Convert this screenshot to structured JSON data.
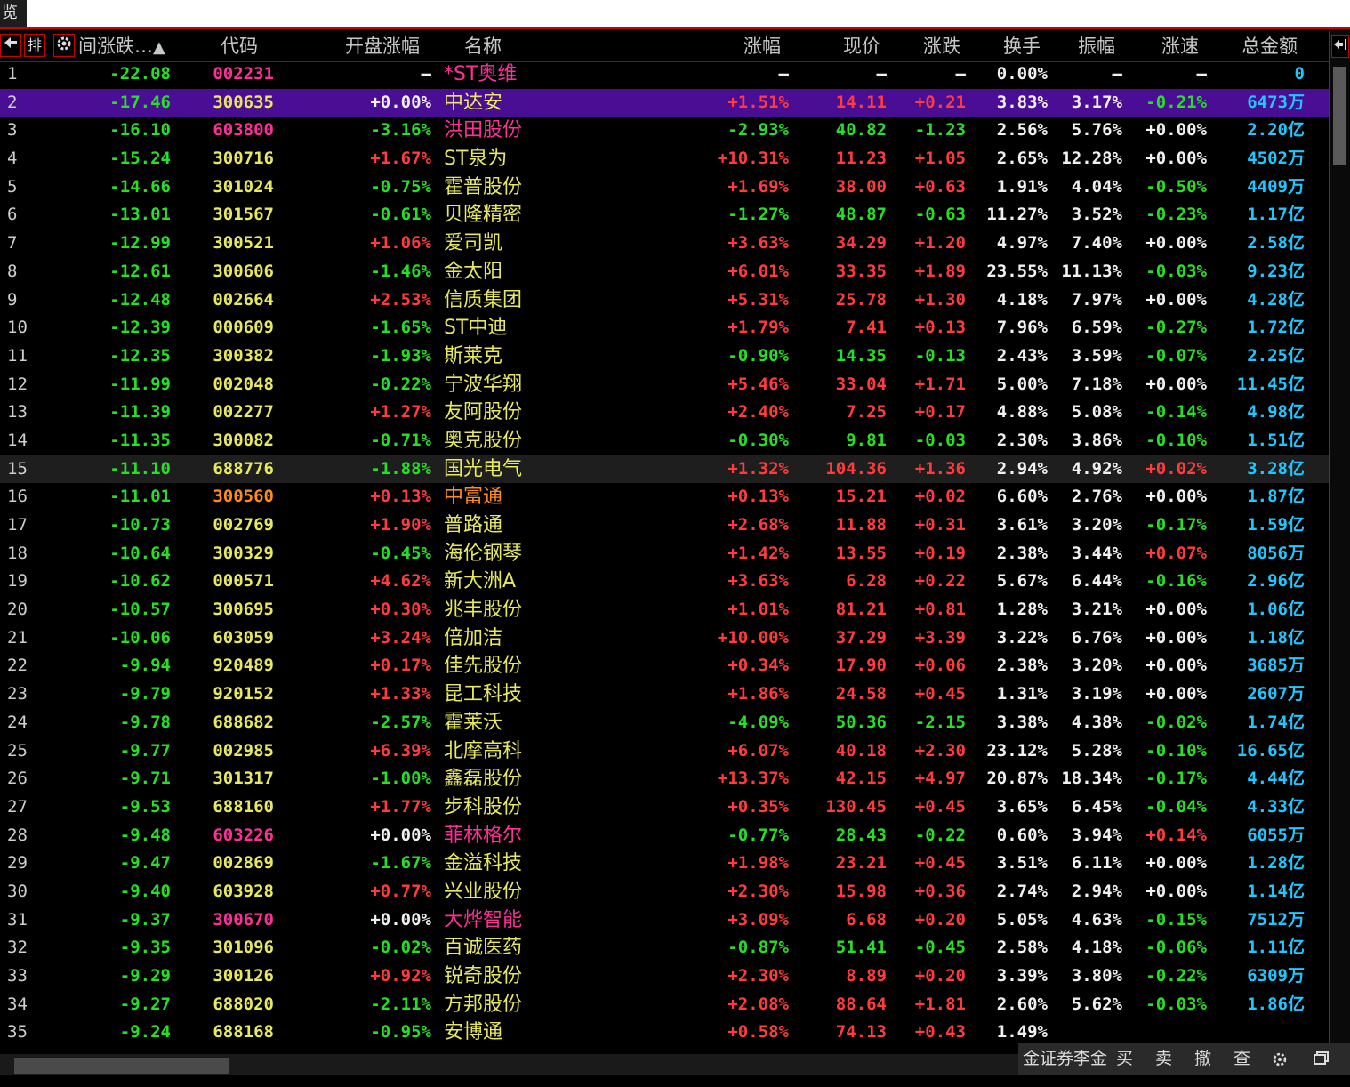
{
  "window": {
    "tab_label": "览"
  },
  "header": {
    "buttons": [
      {
        "icon": "prev-arrow-icon"
      },
      {
        "label": "排"
      },
      {
        "icon": "gear-icon"
      }
    ],
    "sort_column": "间涨跌…",
    "columns": [
      "代码",
      "开盘涨幅",
      "名称",
      "涨幅",
      "现价",
      "涨跌",
      "换手",
      "振幅",
      "涨速",
      "总金额"
    ]
  },
  "rows": [
    {
      "idx": "1",
      "sort": "-22.08",
      "code": "002231",
      "open": "—",
      "name": "*ST奥维",
      "chg": "—",
      "price": "—",
      "delta": "—",
      "turn": "0.00%",
      "amp": "—",
      "speed": "—",
      "amt": "0",
      "cc": "magenta",
      "oc": "white",
      "nc": "magenta",
      "pc": "white",
      "sc": "white"
    },
    {
      "idx": "2",
      "sort": "-17.46",
      "code": "300635",
      "open": "+0.00%",
      "name": "中达安",
      "chg": "+1.51%",
      "price": "14.11",
      "delta": "+0.21",
      "turn": "3.83%",
      "amp": "3.17%",
      "speed": "-0.21%",
      "amt": "6473万",
      "cc": "yellow",
      "oc": "white",
      "nc": "yellow",
      "pc": "red",
      "sc": "green"
    },
    {
      "idx": "3",
      "sort": "-16.10",
      "code": "603800",
      "open": "-3.16%",
      "name": "洪田股份",
      "chg": "-2.93%",
      "price": "40.82",
      "delta": "-1.23",
      "turn": "2.56%",
      "amp": "5.76%",
      "speed": "+0.00%",
      "amt": "2.20亿",
      "cc": "magenta",
      "oc": "green",
      "nc": "magenta",
      "pc": "green",
      "sc": "white"
    },
    {
      "idx": "4",
      "sort": "-15.24",
      "code": "300716",
      "open": "+1.67%",
      "name": "ST泉为",
      "chg": "+10.31%",
      "price": "11.23",
      "delta": "+1.05",
      "turn": "2.65%",
      "amp": "12.28%",
      "speed": "+0.00%",
      "amt": "4502万",
      "cc": "yellow",
      "oc": "red",
      "nc": "yellow",
      "pc": "red",
      "sc": "white"
    },
    {
      "idx": "5",
      "sort": "-14.66",
      "code": "301024",
      "open": "-0.75%",
      "name": "霍普股份",
      "chg": "+1.69%",
      "price": "38.00",
      "delta": "+0.63",
      "turn": "1.91%",
      "amp": "4.04%",
      "speed": "-0.50%",
      "amt": "4409万",
      "cc": "yellow",
      "oc": "green",
      "nc": "yellow",
      "pc": "red",
      "sc": "green"
    },
    {
      "idx": "6",
      "sort": "-13.01",
      "code": "301567",
      "open": "-0.61%",
      "name": "贝隆精密",
      "chg": "-1.27%",
      "price": "48.87",
      "delta": "-0.63",
      "turn": "11.27%",
      "amp": "3.52%",
      "speed": "-0.23%",
      "amt": "1.17亿",
      "cc": "yellow",
      "oc": "green",
      "nc": "yellow",
      "pc": "green",
      "sc": "green"
    },
    {
      "idx": "7",
      "sort": "-12.99",
      "code": "300521",
      "open": "+1.06%",
      "name": "爱司凯",
      "chg": "+3.63%",
      "price": "34.29",
      "delta": "+1.20",
      "turn": "4.97%",
      "amp": "7.40%",
      "speed": "+0.00%",
      "amt": "2.58亿",
      "cc": "yellow",
      "oc": "red",
      "nc": "yellow",
      "pc": "red",
      "sc": "white"
    },
    {
      "idx": "8",
      "sort": "-12.61",
      "code": "300606",
      "open": "-1.46%",
      "name": "金太阳",
      "chg": "+6.01%",
      "price": "33.35",
      "delta": "+1.89",
      "turn": "23.55%",
      "amp": "11.13%",
      "speed": "-0.03%",
      "amt": "9.23亿",
      "cc": "yellow",
      "oc": "green",
      "nc": "yellow",
      "pc": "red",
      "sc": "green"
    },
    {
      "idx": "9",
      "sort": "-12.48",
      "code": "002664",
      "open": "+2.53%",
      "name": "信质集团",
      "chg": "+5.31%",
      "price": "25.78",
      "delta": "+1.30",
      "turn": "4.18%",
      "amp": "7.97%",
      "speed": "+0.00%",
      "amt": "4.28亿",
      "cc": "yellow",
      "oc": "red",
      "nc": "yellow",
      "pc": "red",
      "sc": "white"
    },
    {
      "idx": "10",
      "sort": "-12.39",
      "code": "000609",
      "open": "-1.65%",
      "name": "ST中迪",
      "chg": "+1.79%",
      "price": "7.41",
      "delta": "+0.13",
      "turn": "7.96%",
      "amp": "6.59%",
      "speed": "-0.27%",
      "amt": "1.72亿",
      "cc": "yellow",
      "oc": "green",
      "nc": "yellow",
      "pc": "red",
      "sc": "green"
    },
    {
      "idx": "11",
      "sort": "-12.35",
      "code": "300382",
      "open": "-1.93%",
      "name": "斯莱克",
      "chg": "-0.90%",
      "price": "14.35",
      "delta": "-0.13",
      "turn": "2.43%",
      "amp": "3.59%",
      "speed": "-0.07%",
      "amt": "2.25亿",
      "cc": "yellow",
      "oc": "green",
      "nc": "yellow",
      "pc": "green",
      "sc": "green"
    },
    {
      "idx": "12",
      "sort": "-11.99",
      "code": "002048",
      "open": "-0.22%",
      "name": "宁波华翔",
      "chg": "+5.46%",
      "price": "33.04",
      "delta": "+1.71",
      "turn": "5.00%",
      "amp": "7.18%",
      "speed": "+0.00%",
      "amt": "11.45亿",
      "cc": "yellow",
      "oc": "green",
      "nc": "yellow",
      "pc": "red",
      "sc": "white"
    },
    {
      "idx": "13",
      "sort": "-11.39",
      "code": "002277",
      "open": "+1.27%",
      "name": "友阿股份",
      "chg": "+2.40%",
      "price": "7.25",
      "delta": "+0.17",
      "turn": "4.88%",
      "amp": "5.08%",
      "speed": "-0.14%",
      "amt": "4.98亿",
      "cc": "yellow",
      "oc": "red",
      "nc": "yellow",
      "pc": "red",
      "sc": "green"
    },
    {
      "idx": "14",
      "sort": "-11.35",
      "code": "300082",
      "open": "-0.71%",
      "name": "奥克股份",
      "chg": "-0.30%",
      "price": "9.81",
      "delta": "-0.03",
      "turn": "2.30%",
      "amp": "3.86%",
      "speed": "-0.10%",
      "amt": "1.51亿",
      "cc": "yellow",
      "oc": "green",
      "nc": "yellow",
      "pc": "green",
      "sc": "green"
    },
    {
      "idx": "15",
      "sort": "-11.10",
      "code": "688776",
      "open": "-1.88%",
      "name": "国光电气",
      "chg": "+1.32%",
      "price": "104.36",
      "delta": "+1.36",
      "turn": "2.94%",
      "amp": "4.92%",
      "speed": "+0.02%",
      "amt": "3.28亿",
      "cc": "yellow",
      "oc": "green",
      "nc": "yellow",
      "pc": "red",
      "sc": "red"
    },
    {
      "idx": "16",
      "sort": "-11.01",
      "code": "300560",
      "open": "+0.13%",
      "name": "中富通",
      "chg": "+0.13%",
      "price": "15.21",
      "delta": "+0.02",
      "turn": "6.60%",
      "amp": "2.76%",
      "speed": "+0.00%",
      "amt": "1.87亿",
      "cc": "orange",
      "oc": "red",
      "nc": "orange",
      "pc": "red",
      "sc": "white"
    },
    {
      "idx": "17",
      "sort": "-10.73",
      "code": "002769",
      "open": "+1.90%",
      "name": "普路通",
      "chg": "+2.68%",
      "price": "11.88",
      "delta": "+0.31",
      "turn": "3.61%",
      "amp": "3.20%",
      "speed": "-0.17%",
      "amt": "1.59亿",
      "cc": "yellow",
      "oc": "red",
      "nc": "yellow",
      "pc": "red",
      "sc": "green"
    },
    {
      "idx": "18",
      "sort": "-10.64",
      "code": "300329",
      "open": "-0.45%",
      "name": "海伦钢琴",
      "chg": "+1.42%",
      "price": "13.55",
      "delta": "+0.19",
      "turn": "2.38%",
      "amp": "3.44%",
      "speed": "+0.07%",
      "amt": "8056万",
      "cc": "yellow",
      "oc": "green",
      "nc": "yellow",
      "pc": "red",
      "sc": "red"
    },
    {
      "idx": "19",
      "sort": "-10.62",
      "code": "000571",
      "open": "+4.62%",
      "name": "新大洲A",
      "chg": "+3.63%",
      "price": "6.28",
      "delta": "+0.22",
      "turn": "5.67%",
      "amp": "6.44%",
      "speed": "-0.16%",
      "amt": "2.96亿",
      "cc": "yellow",
      "oc": "red",
      "nc": "yellow",
      "pc": "red",
      "sc": "green"
    },
    {
      "idx": "20",
      "sort": "-10.57",
      "code": "300695",
      "open": "+0.30%",
      "name": "兆丰股份",
      "chg": "+1.01%",
      "price": "81.21",
      "delta": "+0.81",
      "turn": "1.28%",
      "amp": "3.21%",
      "speed": "+0.00%",
      "amt": "1.06亿",
      "cc": "yellow",
      "oc": "red",
      "nc": "yellow",
      "pc": "red",
      "sc": "white"
    },
    {
      "idx": "21",
      "sort": "-10.06",
      "code": "603059",
      "open": "+3.24%",
      "name": "倍加洁",
      "chg": "+10.00%",
      "price": "37.29",
      "delta": "+3.39",
      "turn": "3.22%",
      "amp": "6.76%",
      "speed": "+0.00%",
      "amt": "1.18亿",
      "cc": "yellow",
      "oc": "red",
      "nc": "yellow",
      "pc": "red",
      "sc": "white"
    },
    {
      "idx": "22",
      "sort": "-9.94",
      "code": "920489",
      "open": "+0.17%",
      "name": "佳先股份",
      "chg": "+0.34%",
      "price": "17.90",
      "delta": "+0.06",
      "turn": "2.38%",
      "amp": "3.20%",
      "speed": "+0.00%",
      "amt": "3685万",
      "cc": "yellow",
      "oc": "red",
      "nc": "yellow",
      "pc": "red",
      "sc": "white"
    },
    {
      "idx": "23",
      "sort": "-9.79",
      "code": "920152",
      "open": "+1.33%",
      "name": "昆工科技",
      "chg": "+1.86%",
      "price": "24.58",
      "delta": "+0.45",
      "turn": "1.31%",
      "amp": "3.19%",
      "speed": "+0.00%",
      "amt": "2607万",
      "cc": "yellow",
      "oc": "red",
      "nc": "yellow",
      "pc": "red",
      "sc": "white"
    },
    {
      "idx": "24",
      "sort": "-9.78",
      "code": "688682",
      "open": "-2.57%",
      "name": "霍莱沃",
      "chg": "-4.09%",
      "price": "50.36",
      "delta": "-2.15",
      "turn": "3.38%",
      "amp": "4.38%",
      "speed": "-0.02%",
      "amt": "1.74亿",
      "cc": "yellow",
      "oc": "green",
      "nc": "yellow",
      "pc": "green",
      "sc": "green"
    },
    {
      "idx": "25",
      "sort": "-9.77",
      "code": "002985",
      "open": "+6.39%",
      "name": "北摩高科",
      "chg": "+6.07%",
      "price": "40.18",
      "delta": "+2.30",
      "turn": "23.12%",
      "amp": "5.28%",
      "speed": "-0.10%",
      "amt": "16.65亿",
      "cc": "yellow",
      "oc": "red",
      "nc": "yellow",
      "pc": "red",
      "sc": "green"
    },
    {
      "idx": "26",
      "sort": "-9.71",
      "code": "301317",
      "open": "-1.00%",
      "name": "鑫磊股份",
      "chg": "+13.37%",
      "price": "42.15",
      "delta": "+4.97",
      "turn": "20.87%",
      "amp": "18.34%",
      "speed": "-0.17%",
      "amt": "4.44亿",
      "cc": "yellow",
      "oc": "green",
      "nc": "yellow",
      "pc": "red",
      "sc": "green"
    },
    {
      "idx": "27",
      "sort": "-9.53",
      "code": "688160",
      "open": "+1.77%",
      "name": "步科股份",
      "chg": "+0.35%",
      "price": "130.45",
      "delta": "+0.45",
      "turn": "3.65%",
      "amp": "6.45%",
      "speed": "-0.04%",
      "amt": "4.33亿",
      "cc": "yellow",
      "oc": "red",
      "nc": "yellow",
      "pc": "red",
      "sc": "green"
    },
    {
      "idx": "28",
      "sort": "-9.48",
      "code": "603226",
      "open": "+0.00%",
      "name": "菲林格尔",
      "chg": "-0.77%",
      "price": "28.43",
      "delta": "-0.22",
      "turn": "0.60%",
      "amp": "3.94%",
      "speed": "+0.14%",
      "amt": "6055万",
      "cc": "magenta",
      "oc": "white",
      "nc": "magenta",
      "pc": "green",
      "sc": "red"
    },
    {
      "idx": "29",
      "sort": "-9.47",
      "code": "002869",
      "open": "-1.67%",
      "name": "金溢科技",
      "chg": "+1.98%",
      "price": "23.21",
      "delta": "+0.45",
      "turn": "3.51%",
      "amp": "6.11%",
      "speed": "+0.00%",
      "amt": "1.28亿",
      "cc": "yellow",
      "oc": "green",
      "nc": "yellow",
      "pc": "red",
      "sc": "white"
    },
    {
      "idx": "30",
      "sort": "-9.40",
      "code": "603928",
      "open": "+0.77%",
      "name": "兴业股份",
      "chg": "+2.30%",
      "price": "15.98",
      "delta": "+0.36",
      "turn": "2.74%",
      "amp": "2.94%",
      "speed": "+0.00%",
      "amt": "1.14亿",
      "cc": "yellow",
      "oc": "red",
      "nc": "yellow",
      "pc": "red",
      "sc": "white"
    },
    {
      "idx": "31",
      "sort": "-9.37",
      "code": "300670",
      "open": "+0.00%",
      "name": "大烨智能",
      "chg": "+3.09%",
      "price": "6.68",
      "delta": "+0.20",
      "turn": "5.05%",
      "amp": "4.63%",
      "speed": "-0.15%",
      "amt": "7512万",
      "cc": "magenta",
      "oc": "white",
      "nc": "magenta",
      "pc": "red",
      "sc": "green"
    },
    {
      "idx": "32",
      "sort": "-9.35",
      "code": "301096",
      "open": "-0.02%",
      "name": "百诚医药",
      "chg": "-0.87%",
      "price": "51.41",
      "delta": "-0.45",
      "turn": "2.58%",
      "amp": "4.18%",
      "speed": "-0.06%",
      "amt": "1.11亿",
      "cc": "yellow",
      "oc": "green",
      "nc": "yellow",
      "pc": "green",
      "sc": "green"
    },
    {
      "idx": "33",
      "sort": "-9.29",
      "code": "300126",
      "open": "+0.92%",
      "name": "锐奇股份",
      "chg": "+2.30%",
      "price": "8.89",
      "delta": "+0.20",
      "turn": "3.39%",
      "amp": "3.80%",
      "speed": "-0.22%",
      "amt": "6309万",
      "cc": "yellow",
      "oc": "red",
      "nc": "yellow",
      "pc": "red",
      "sc": "green"
    },
    {
      "idx": "34",
      "sort": "-9.27",
      "code": "688020",
      "open": "-2.11%",
      "name": "方邦股份",
      "chg": "+2.08%",
      "price": "88.64",
      "delta": "+1.81",
      "turn": "2.60%",
      "amp": "5.62%",
      "speed": "-0.03%",
      "amt": "1.86亿",
      "cc": "yellow",
      "oc": "green",
      "nc": "yellow",
      "pc": "red",
      "sc": "green"
    },
    {
      "idx": "35",
      "sort": "-9.24",
      "code": "688168",
      "open": "-0.95%",
      "name": "安博通",
      "chg": "+0.58%",
      "price": "74.13",
      "delta": "+0.43",
      "turn": "1.49%",
      "amp": "",
      "speed": "",
      "amt": "",
      "cc": "yellow",
      "oc": "green",
      "nc": "yellow",
      "pc": "red",
      "sc": "green"
    }
  ],
  "selected_row": "2",
  "highlighted_row": "15",
  "statusbar": {
    "broker": "金证券李金",
    "buy": "买",
    "sell": "卖",
    "cancel": "撤",
    "query": "查"
  },
  "colors": {
    "up": "#ff3b3b",
    "down": "#25e025",
    "selected": "#4a0e94",
    "amount": "#21c6ff",
    "alert_border": "#d00000"
  }
}
